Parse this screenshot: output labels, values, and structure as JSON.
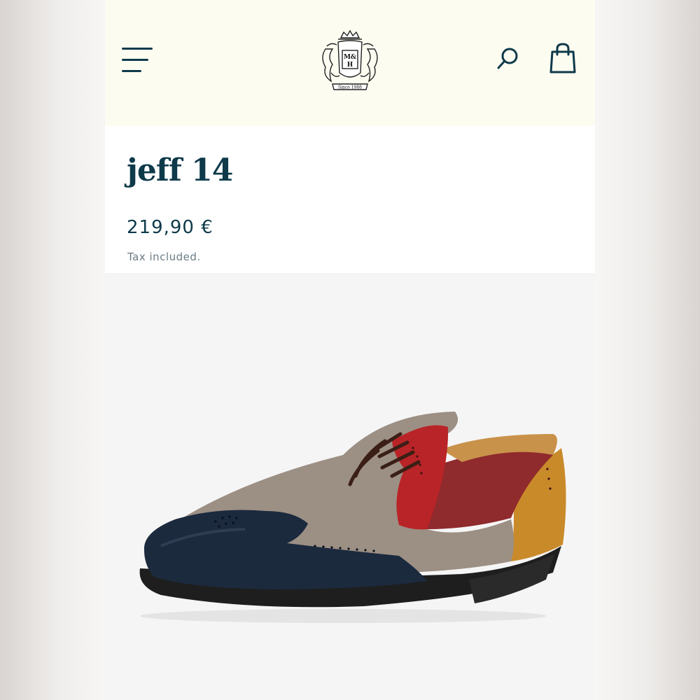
{
  "header": {
    "brand": {
      "monogram_top": "M&",
      "monogram_bottom": "H",
      "since": "Since 1988"
    },
    "menu_icon": "hamburger-menu-icon",
    "search_icon": "search-icon",
    "cart_icon": "shopping-bag-icon"
  },
  "product": {
    "name": "jeff 14",
    "price": "219,90 €",
    "tax_note": "Tax included."
  },
  "gallery": {
    "image_subject": "two-tone wingtip derby shoe",
    "colors": {
      "toe": "#1c2a3e",
      "vamp": "#9c8f84",
      "eyestay": "#b82427",
      "quarter": "#8f2a2d",
      "heel": "#c98a2a",
      "sole": "#1e1e1e",
      "laces": "#3a1f16"
    }
  },
  "theme": {
    "header_bg": "#fdfcf1",
    "primary": "#0e3a4a",
    "muted_text": "#6b7b86"
  }
}
